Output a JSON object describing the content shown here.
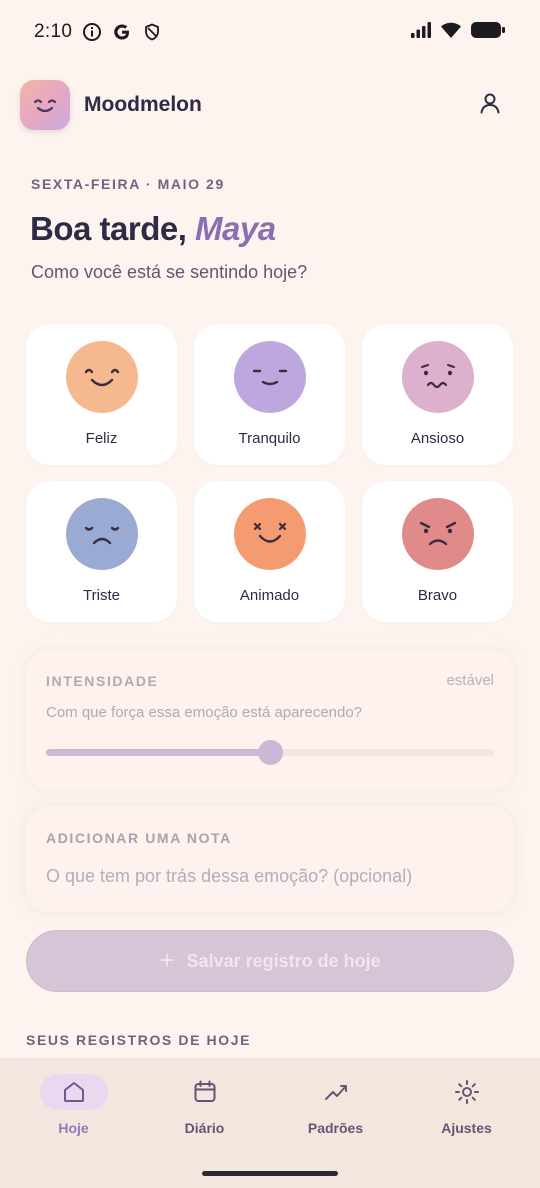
{
  "status_bar": {
    "time": "2:10",
    "icons": [
      "info-icon",
      "google-icon",
      "shield-icon",
      "signal-icon",
      "wifi-icon",
      "battery-icon"
    ]
  },
  "header": {
    "app_name": "Moodmelon",
    "logo_icon": "smiley-logo-icon",
    "profile_icon": "person-icon"
  },
  "greeting": {
    "date": "SEXTA-FEIRA · MAIO 29",
    "salutation": "Boa tarde,",
    "user_name": "Maya",
    "question": "Como você está se sentindo hoje?"
  },
  "moods": [
    {
      "label": "Feliz",
      "color": "#f6b98f",
      "face": "happy"
    },
    {
      "label": "Tranquilo",
      "color": "#bda7de",
      "face": "calm"
    },
    {
      "label": "Ansioso",
      "color": "#ddb0cd",
      "face": "anxious"
    },
    {
      "label": "Triste",
      "color": "#9aaad2",
      "face": "sad"
    },
    {
      "label": "Animado",
      "color": "#f59b72",
      "face": "excited"
    },
    {
      "label": "Bravo",
      "color": "#e08a8a",
      "face": "angry"
    }
  ],
  "intensity": {
    "title": "INTENSIDADE",
    "value_label": "estável",
    "question": "Com que força essa emoção está aparecendo?",
    "level": 0.5
  },
  "note": {
    "title": "ADICIONAR UMA NOTA",
    "placeholder": "O que tem por trás dessa emoção? (opcional)",
    "value": ""
  },
  "save_button": {
    "icon": "plus-icon",
    "label": "Salvar registro de hoje"
  },
  "section": {
    "today_entries": "SEUS REGISTROS DE HOJE"
  },
  "bottom_nav": {
    "items": [
      {
        "label": "Hoje",
        "icon": "home-icon",
        "active": true
      },
      {
        "label": "Diário",
        "icon": "calendar-icon",
        "active": false
      },
      {
        "label": "Padrões",
        "icon": "trend-icon",
        "active": false
      },
      {
        "label": "Ajustes",
        "icon": "sun-settings-icon",
        "active": false
      }
    ]
  },
  "colors": {
    "background": "#fdf4ef",
    "accent": "#8a6fb3",
    "nav_background": "#f4e6de"
  }
}
